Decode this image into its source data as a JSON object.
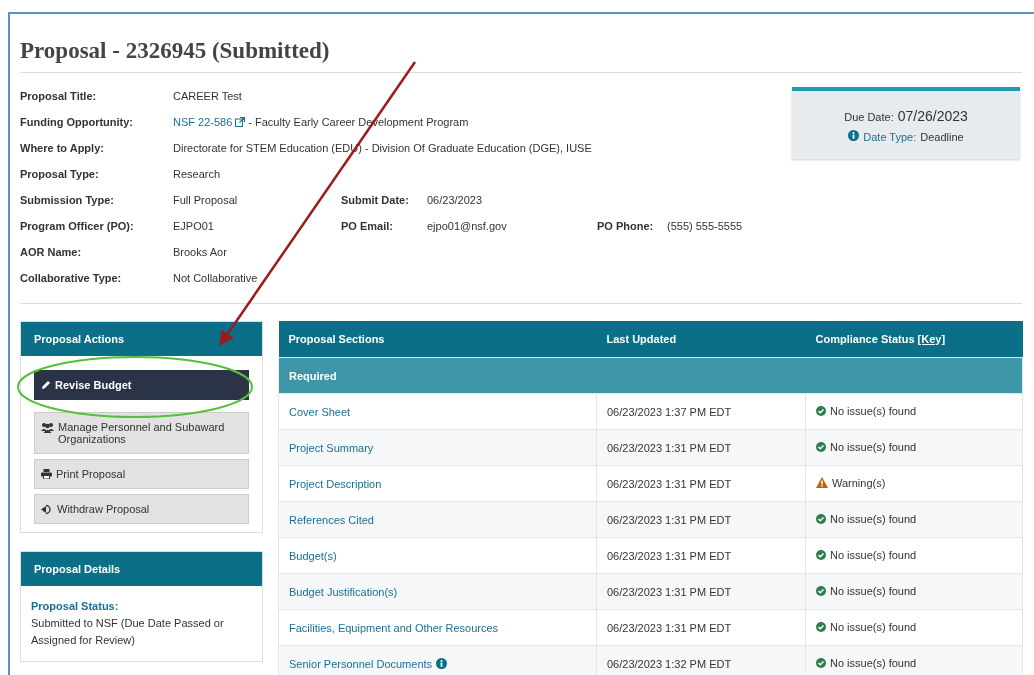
{
  "page_title": "Proposal - 2326945 (Submitted)",
  "details": [
    {
      "fields": [
        {
          "label": "Proposal Title:",
          "value": "CAREER Test"
        }
      ]
    },
    {
      "fields": [
        {
          "label": "Funding Opportunity:",
          "link": "NSF 22-586",
          "value": " - Faculty Early Career Development Program"
        }
      ]
    },
    {
      "fields": [
        {
          "label": "Where to Apply:",
          "value": "Directorate for STEM Education (EDU) - Division Of Graduate Education (DGE), IUSE"
        }
      ]
    },
    {
      "fields": [
        {
          "label": "Proposal Type:",
          "value": "Research"
        }
      ]
    },
    {
      "fields": [
        {
          "label": "Submission Type:",
          "value": "Full Proposal"
        },
        {
          "label": "Submit Date:",
          "value": "06/23/2023"
        }
      ]
    },
    {
      "fields": [
        {
          "label": "Program Officer (PO):",
          "value": "EJPO01"
        },
        {
          "label": "PO Email:",
          "value": "ejpo01@nsf.gov"
        },
        {
          "label": "PO Phone:",
          "value": "(555) 555-5555"
        }
      ]
    },
    {
      "fields": [
        {
          "label": "AOR Name:",
          "value": "Brooks Aor"
        }
      ]
    },
    {
      "fields": [
        {
          "label": "Collaborative Type:",
          "value": "Not Collaborative"
        }
      ]
    }
  ],
  "due_box": {
    "label": "Due Date:",
    "date": "07/26/2023",
    "type_label": "Date Type:",
    "type_value": "Deadline"
  },
  "actions_panel": {
    "title": "Proposal Actions",
    "buttons": [
      {
        "label": "Revise Budget",
        "kind": "edit",
        "primary": true
      },
      {
        "label": "Manage Personnel and Subaward Organizations",
        "kind": "people",
        "primary": false
      },
      {
        "label": "Print Proposal",
        "kind": "print",
        "primary": false
      },
      {
        "label": "Withdraw Proposal",
        "kind": "withdraw",
        "primary": false
      }
    ]
  },
  "details_panel": {
    "title": "Proposal Details",
    "status_label": "Proposal Status:",
    "status_value": "Submitted to NSF (Due Date Passed or Assigned for Review)"
  },
  "table": {
    "columns": [
      "Proposal Sections",
      "Last Updated",
      "Compliance Status"
    ],
    "key_link": "[Key]",
    "group": "Required",
    "rows": [
      {
        "section": "Cover Sheet",
        "info": false,
        "updated": "06/23/2023 1:37 PM EDT",
        "status": "No issue(s) found",
        "kind": "ok"
      },
      {
        "section": "Project Summary",
        "info": false,
        "updated": "06/23/2023 1:31 PM EDT",
        "status": "No issue(s) found",
        "kind": "ok"
      },
      {
        "section": "Project Description",
        "info": false,
        "updated": "06/23/2023 1:31 PM EDT",
        "status": "Warning(s)",
        "kind": "warning"
      },
      {
        "section": "References Cited",
        "info": false,
        "updated": "06/23/2023 1:31 PM EDT",
        "status": "No issue(s) found",
        "kind": "ok"
      },
      {
        "section": "Budget(s)",
        "info": false,
        "updated": "06/23/2023 1:31 PM EDT",
        "status": "No issue(s) found",
        "kind": "ok"
      },
      {
        "section": "Budget Justification(s)",
        "info": false,
        "updated": "06/23/2023 1:31 PM EDT",
        "status": "No issue(s) found",
        "kind": "ok"
      },
      {
        "section": "Facilities, Equipment and Other Resources",
        "info": false,
        "updated": "06/23/2023 1:31 PM EDT",
        "status": "No issue(s) found",
        "kind": "ok"
      },
      {
        "section": "Senior Personnel Documents",
        "info": true,
        "updated": "06/23/2023 1:32 PM EDT",
        "status": "No issue(s) found",
        "kind": "ok"
      }
    ]
  }
}
